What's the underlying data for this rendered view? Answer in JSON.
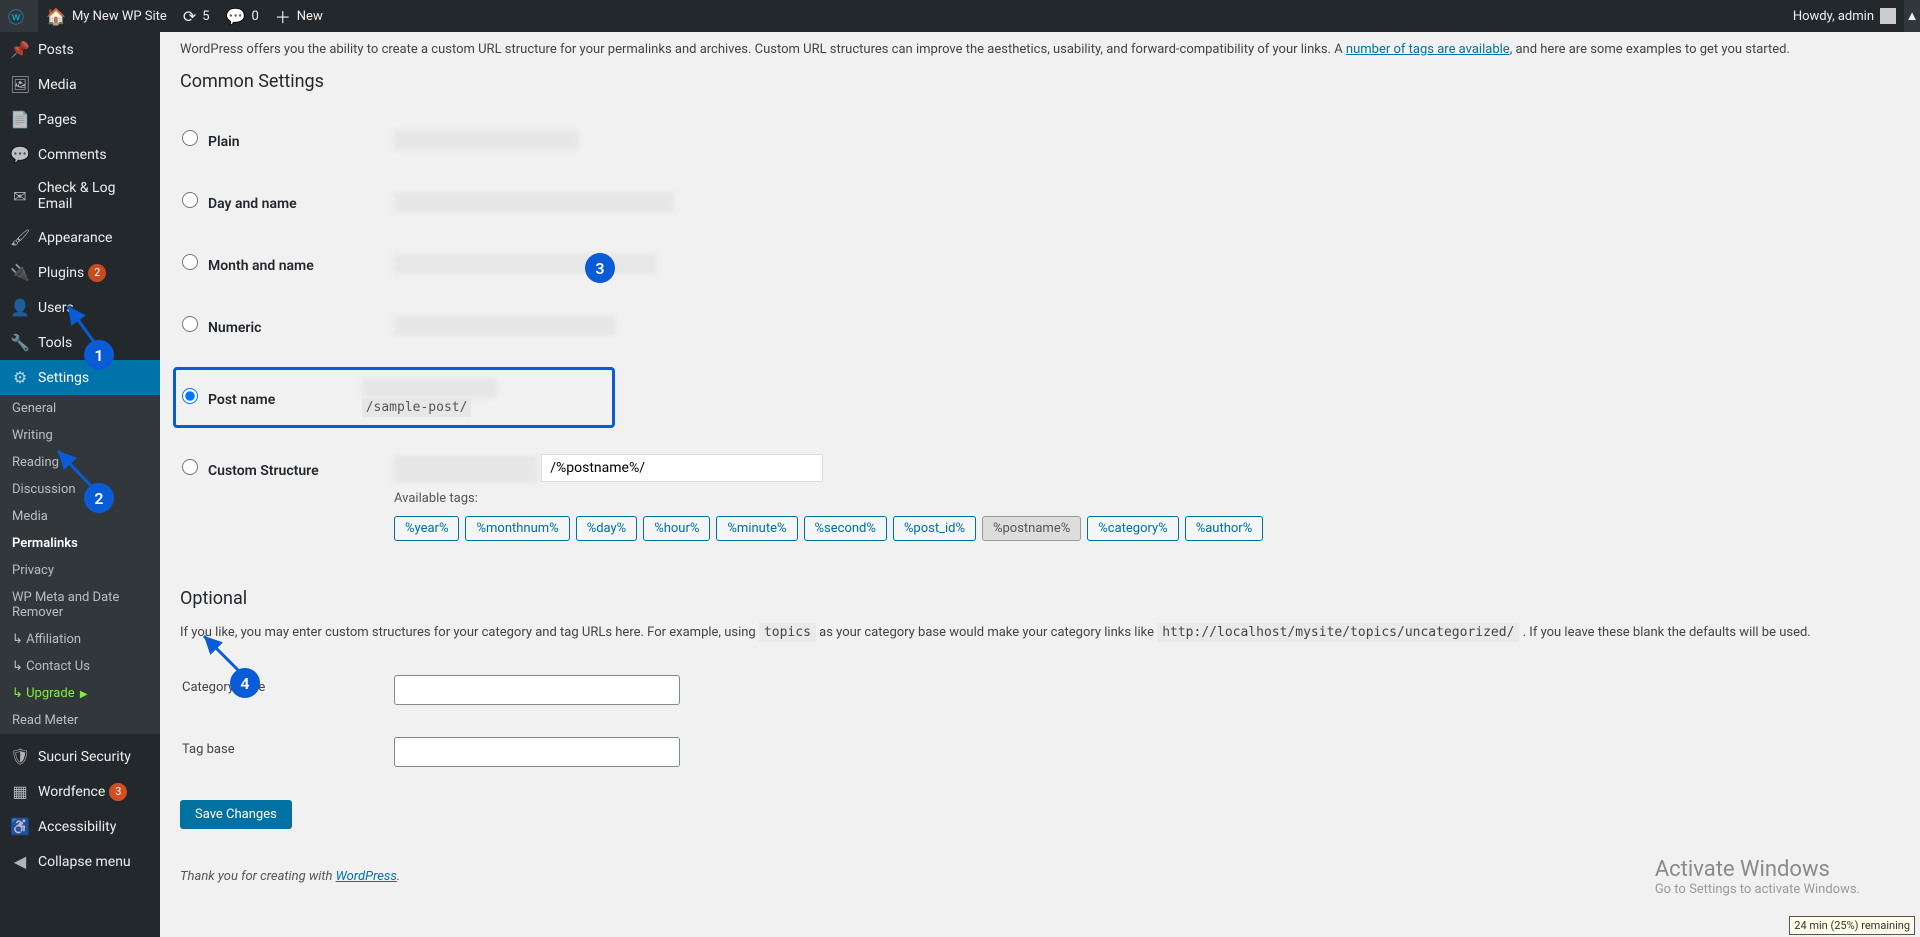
{
  "adminbar": {
    "site_name": "My New WP Site",
    "updates_count": "5",
    "comments_count": "0",
    "new_label": "New",
    "howdy": "Howdy, admin"
  },
  "sidebar": {
    "items": [
      {
        "icon": "📌",
        "label": "Posts"
      },
      {
        "icon": "🖼",
        "label": "Media"
      },
      {
        "icon": "📄",
        "label": "Pages"
      },
      {
        "icon": "💬",
        "label": "Comments"
      },
      {
        "icon": "✉",
        "label": "Check & Log Email"
      },
      {
        "icon": "🖌",
        "label": "Appearance"
      },
      {
        "icon": "🔌",
        "label": "Plugins",
        "badge": "2",
        "badge_class": "red"
      },
      {
        "icon": "👤",
        "label": "Users"
      },
      {
        "icon": "🔧",
        "label": "Tools"
      },
      {
        "icon": "⚙",
        "label": "Settings",
        "current": true
      }
    ],
    "submenu": [
      {
        "label": "General"
      },
      {
        "label": "Writing"
      },
      {
        "label": "Reading"
      },
      {
        "label": "Discussion"
      },
      {
        "label": "Media"
      },
      {
        "label": "Permalinks",
        "current": true
      },
      {
        "label": "Privacy"
      },
      {
        "label": "WP Meta and Date Remover"
      },
      {
        "label": "Affiliation",
        "prefix": "↳"
      },
      {
        "label": "Contact Us",
        "prefix": "↳"
      },
      {
        "label": "Upgrade",
        "prefix": "↳",
        "upgrade": true
      },
      {
        "label": "Read Meter"
      }
    ],
    "footer_items": [
      {
        "icon": "🛡",
        "label": "Sucuri Security"
      },
      {
        "icon": "▦",
        "label": "Wordfence",
        "badge": "3",
        "badge_class": "orange"
      },
      {
        "icon": "♿",
        "label": "Accessibility"
      },
      {
        "icon": "◀",
        "label": "Collapse menu"
      }
    ]
  },
  "content": {
    "intro_pre": "WordPress offers you the ability to create a custom URL structure for your permalinks and archives. Custom URL structures can improve the aesthetics, usability, and forward-compatibility of your links. A ",
    "intro_link": "number of tags are available",
    "intro_post": ", and here are some examples to get you started.",
    "common_heading": "Common Settings",
    "options": {
      "plain": "Plain",
      "day": "Day and name",
      "month": "Month and name",
      "numeric": "Numeric",
      "postname": "Post name",
      "postname_sample": "/sample-post/",
      "custom": "Custom Structure",
      "custom_value": "/%postname%/",
      "avail_label": "Available tags:"
    },
    "tags": [
      "%year%",
      "%monthnum%",
      "%day%",
      "%hour%",
      "%minute%",
      "%second%",
      "%post_id%",
      "%postname%",
      "%category%",
      "%author%"
    ],
    "active_tag": "%postname%",
    "optional_heading": "Optional",
    "optional_desc_pre": "If you like, you may enter custom structures for your category and tag URLs here. For example, using ",
    "optional_code1": "topics",
    "optional_desc_mid": " as your category base would make your category links like ",
    "optional_code2": "http://localhost/mysite/topics/uncategorized/",
    "optional_desc_post": " . If you leave these blank the defaults will be used.",
    "category_base": "Category base",
    "tag_base": "Tag base",
    "save": "Save Changes",
    "footer_pre": "Thank you for creating with ",
    "footer_link": "WordPress",
    "footer_post": "."
  },
  "watermark": {
    "t1": "Activate Windows",
    "t2": "Go to Settings to activate Windows."
  },
  "battery": "24 min (25%) remaining"
}
